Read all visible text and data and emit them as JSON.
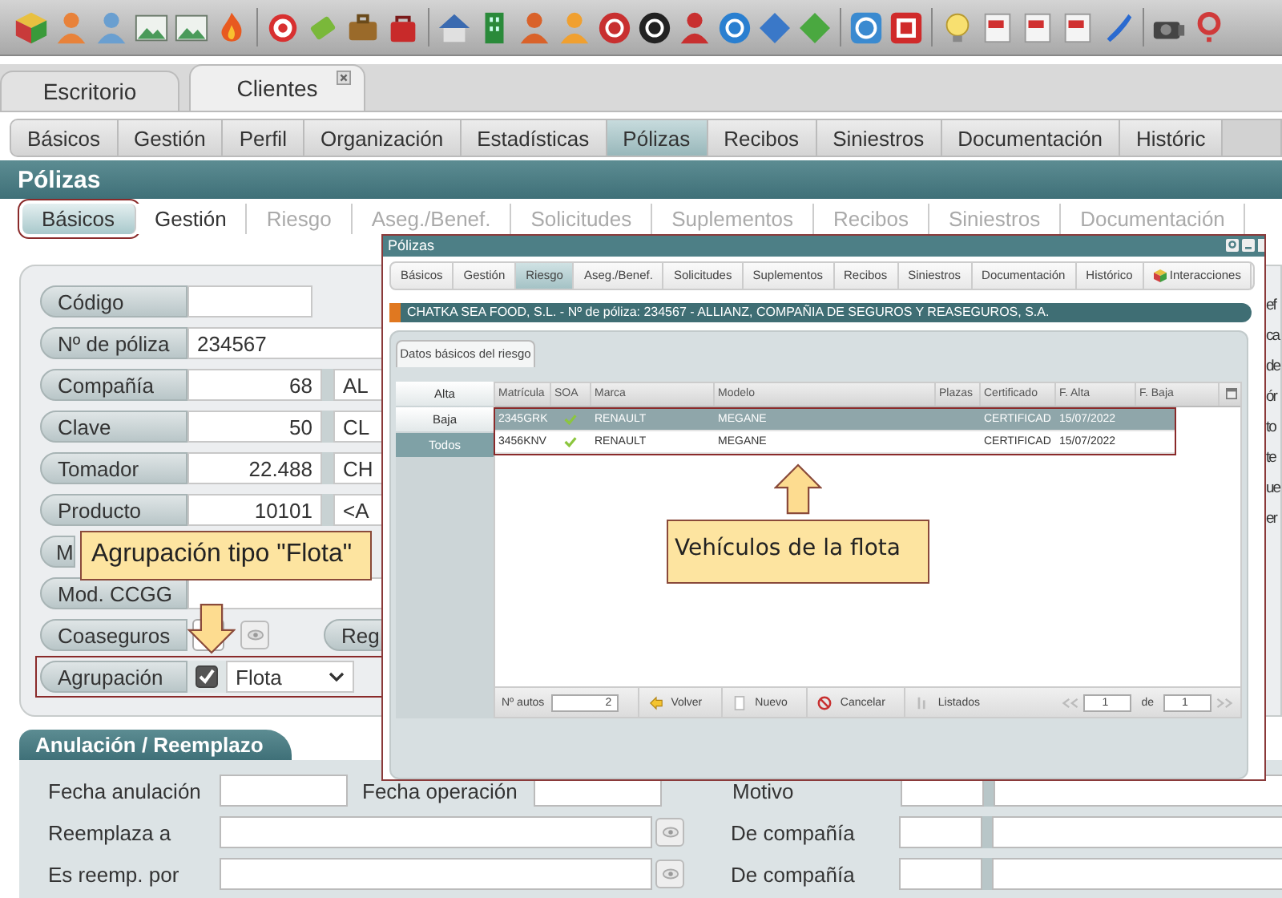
{
  "main_tabs": [
    {
      "label": "Escritorio",
      "selected": false,
      "closable": false
    },
    {
      "label": "Clientes",
      "selected": true,
      "closable": true
    }
  ],
  "nav_tabs": [
    {
      "label": "Básicos",
      "selected": false
    },
    {
      "label": "Gestión",
      "selected": false
    },
    {
      "label": "Perfil",
      "selected": false
    },
    {
      "label": "Organización",
      "selected": false
    },
    {
      "label": "Estadísticas",
      "selected": false
    },
    {
      "label": "Pólizas",
      "selected": true
    },
    {
      "label": "Recibos",
      "selected": false
    },
    {
      "label": "Siniestros",
      "selected": false
    },
    {
      "label": "Documentación",
      "selected": false
    },
    {
      "label": "Históric",
      "selected": false
    }
  ],
  "section_title": "Pólizas",
  "sub_tabs": [
    {
      "label": "Básicos",
      "selected": true,
      "disabled": false,
      "framed": true
    },
    {
      "label": "Gestión",
      "selected": false,
      "disabled": false,
      "framed": false
    },
    {
      "label": "Riesgo",
      "selected": false,
      "disabled": true,
      "framed": false
    },
    {
      "label": "Aseg./Benef.",
      "selected": false,
      "disabled": true,
      "framed": false
    },
    {
      "label": "Solicitudes",
      "selected": false,
      "disabled": true,
      "framed": false
    },
    {
      "label": "Suplementos",
      "selected": false,
      "disabled": true,
      "framed": false
    },
    {
      "label": "Recibos",
      "selected": false,
      "disabled": true,
      "framed": false
    },
    {
      "label": "Siniestros",
      "selected": false,
      "disabled": true,
      "framed": false
    },
    {
      "label": "Documentación",
      "selected": false,
      "disabled": true,
      "framed": false
    }
  ],
  "form": [
    {
      "kind": "short",
      "label": "Código",
      "framed": false
    },
    {
      "kind": "text",
      "label": "Nº de póliza",
      "value": "234567",
      "framed": false
    },
    {
      "kind": "code",
      "label": "Compañía",
      "code": "68",
      "name": "AL",
      "framed": false
    },
    {
      "kind": "code",
      "label": "Clave",
      "code": "50",
      "name": "CL",
      "framed": false
    },
    {
      "kind": "code",
      "label": "Tomador",
      "code": "22.488",
      "name": "CH",
      "framed": false
    },
    {
      "kind": "code",
      "label": "Producto",
      "code": "10101",
      "name": "<A",
      "framed": false
    },
    {
      "kind": "covered",
      "label": "M",
      "framed": false
    },
    {
      "kind": "text",
      "label": "Mod. CCGG",
      "framed": false
    },
    {
      "kind": "toggle",
      "label": "Coaseguros",
      "extra_label": "Reg",
      "framed": false
    },
    {
      "kind": "select",
      "label": "Agrupación",
      "checked": true,
      "value": "Flota",
      "framed": true
    }
  ],
  "right_fragments": [
    "ef",
    "ca",
    "de",
    "ór",
    "to",
    "te",
    "ue",
    "er"
  ],
  "callouts": [
    {
      "text": "Agrupación tipo \"Flota\"",
      "kind": "down"
    },
    {
      "text": "Vehículos de la flota",
      "kind": "up"
    }
  ],
  "modal": {
    "title": "Pólizas",
    "tabs": [
      {
        "label": "Básicos",
        "selected": false,
        "has_icon": false
      },
      {
        "label": "Gestión",
        "selected": false,
        "has_icon": false
      },
      {
        "label": "Riesgo",
        "selected": true,
        "has_icon": false
      },
      {
        "label": "Aseg./Benef.",
        "selected": false,
        "has_icon": false
      },
      {
        "label": "Solicitudes",
        "selected": false,
        "has_icon": false
      },
      {
        "label": "Suplementos",
        "selected": false,
        "has_icon": false
      },
      {
        "label": "Recibos",
        "selected": false,
        "has_icon": false
      },
      {
        "label": "Siniestros",
        "selected": false,
        "has_icon": false
      },
      {
        "label": "Documentación",
        "selected": false,
        "has_icon": false
      },
      {
        "label": "Histórico",
        "selected": false,
        "has_icon": false
      },
      {
        "label": "Interacciones",
        "selected": false,
        "has_icon": true
      }
    ],
    "header": "CHATKA SEA FOOD, S.L. - Nº de póliza: 234567 - ALLIANZ, COMPAÑIA DE SEGUROS Y REASEGUROS, S.A.",
    "panel_tab": "Datos básicos del riesgo",
    "filters": [
      {
        "label": "Alta",
        "selected": false
      },
      {
        "label": "Baja",
        "selected": false
      },
      {
        "label": "Todos",
        "selected": true
      }
    ],
    "table": {
      "columns": [
        "Matrícula",
        "SOA",
        "Marca",
        "Modelo",
        "Plazas",
        "Certificado",
        "F. Alta",
        "F. Baja"
      ],
      "rows_framed": true,
      "rows": [
        {
          "selected": true,
          "matricula": "2345GRK",
          "soa": true,
          "marca": "RENAULT",
          "modelo": "MEGANE",
          "certificado": "CERTIFICAD",
          "f_alta": "15/07/2022"
        },
        {
          "selected": false,
          "matricula": "3456KNV",
          "soa": true,
          "marca": "RENAULT",
          "modelo": "MEGANE",
          "certificado": "CERTIFICAD",
          "f_alta": "15/07/2022"
        }
      ]
    },
    "footer": {
      "count_label": "Nº autos",
      "count": "2",
      "actions": [
        {
          "label": "Volver",
          "kind": "back"
        },
        {
          "label": "Nuevo",
          "kind": "new"
        },
        {
          "label": "Cancelar",
          "kind": "cancel"
        },
        {
          "label": "Listados",
          "kind": "list"
        }
      ],
      "page": "1",
      "of_label": "de",
      "total": "1"
    }
  },
  "anulacion": {
    "title": "Anulación / Reemplazo",
    "rows": [
      {
        "kind": "dates",
        "label": "Fecha anulación",
        "second_label": "Fecha operación",
        "right_label": "Motivo"
      },
      {
        "kind": "lookup",
        "label": "Reemplaza a",
        "right_label": "De compañía"
      },
      {
        "kind": "lookup",
        "label": "Es reemp. por",
        "right_label": "De compañía"
      }
    ]
  }
}
